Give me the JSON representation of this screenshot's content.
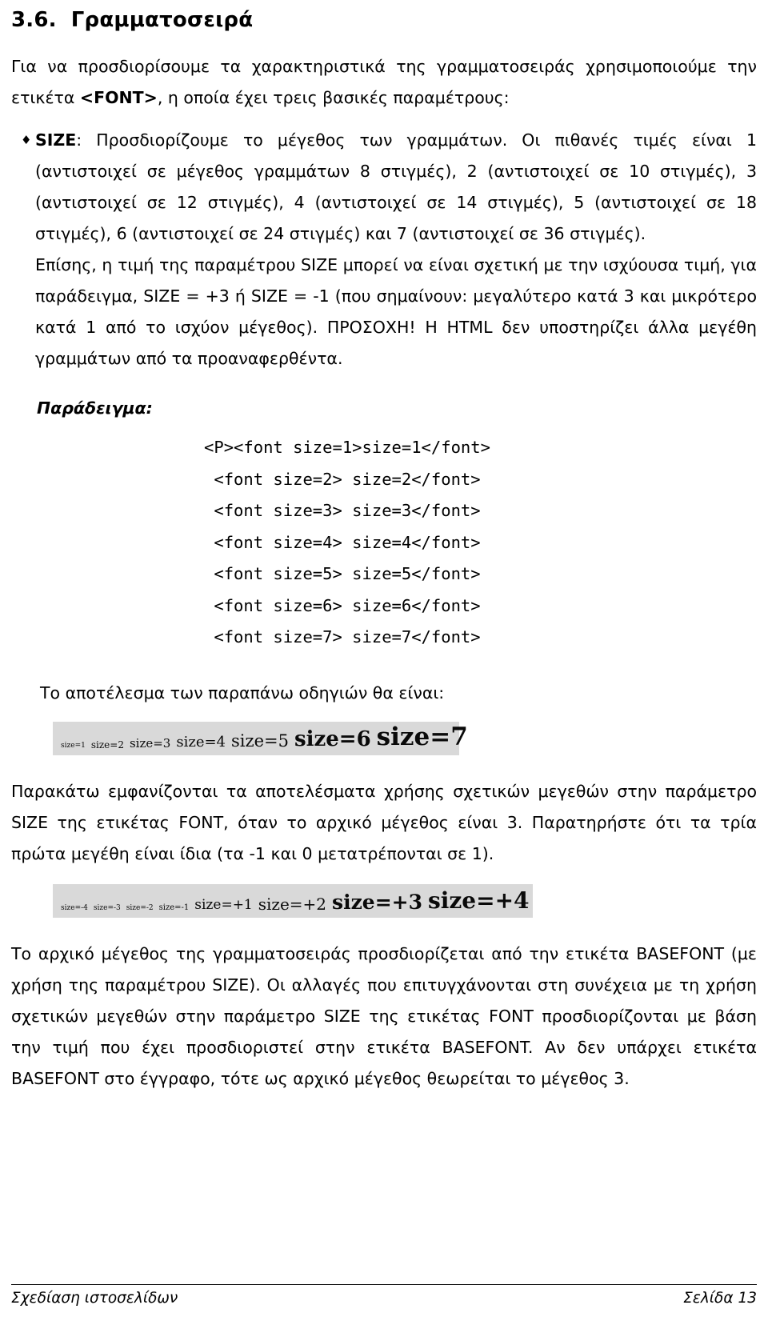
{
  "document": {
    "section": {
      "number": "3.6.",
      "title": "Γραμματοσειρά"
    },
    "intro": {
      "part1": "Για να προσδιορίσουμε τα χαρακτηριστικά της γραμματοσειράς χρησιμοποιούμε την ετικέτα ",
      "tag": "<FONT>",
      "part2": ", η οποία έχει τρεις βασικές παραμέτρους:"
    },
    "bullet": {
      "marker": "♦",
      "lead": "SIZE",
      "text": ": Προσδιορίζουμε το μέγεθος των γραμμάτων. Οι πιθανές τιμές είναι 1 (αντιστοιχεί σε μέγεθος γραμμάτων 8 στιγμές), 2 (αντιστοιχεί σε 10 στιγμές), 3 (αντιστοιχεί σε 12 στιγμές), 4 (αντιστοιχεί σε 14 στιγμές), 5 (αντιστοιχεί σε 18 στιγμές), 6 (αντιστοιχεί σε 24 στιγμές) και 7 (αντιστοιχεί σε 36 στιγμές).",
      "text2": "Επίσης, η τιμή της παραμέτρου SIZE μπορεί να είναι σχετική με την ισχύουσα τιμή, για παράδειγμα, SIZE = +3 ή SIZE = -1 (που σημαίνουν: μεγαλύτερο κατά 3 και μικρότερο κατά 1 από το ισχύον μέγεθος). ΠΡΟΣΟΧΗ! Η HTML δεν υποστηρίζει άλλα μεγέθη γραμμάτων από τα προαναφερθέντα."
    },
    "example": {
      "label": "Παράδειγμα:",
      "lines": [
        "<P><font size=1>size=1</font>",
        "<font size=2> size=2</font>",
        "<font size=3> size=3</font>",
        "<font size=4> size=4</font>",
        "<font size=5> size=5</font>",
        "<font size=6> size=6</font>",
        "<font size=7> size=7</font>"
      ]
    },
    "result_caption": "Το αποτέλεσμα των παραπάνω οδηγιών θα είναι:",
    "figure1": {
      "background_color": "#d9d9d9",
      "samples": [
        "size=1",
        "size=2",
        "size=3",
        "size=4",
        "size=5",
        "size=6",
        "size=7"
      ]
    },
    "paragraph_after_fig1": "Παρακάτω εμφανίζονται τα αποτελέσματα χρήσης σχετικών μεγεθών στην παράμετρο SIZE της ετικέτας FONT, όταν το αρχικό μέγεθος είναι 3. Παρατηρήστε ότι τα τρία πρώτα μεγέθη είναι ίδια (τα -1 και 0 μετατρέπονται σε 1).",
    "figure2": {
      "background_color": "#d9d9d9",
      "samples": [
        "size=-4",
        "size=-3",
        "size=-2",
        "size=-1",
        "size=+1",
        "size=+2",
        "size=+3",
        "size=+4"
      ]
    },
    "paragraph_after_fig2": "Το αρχικό μέγεθος της γραμματοσειράς προσδιορίζεται από την ετικέτα BASEFONT (με χρήση της παραμέτρου SIZE). Οι αλλαγές που επιτυγχάνονται στη συνέχεια με τη χρήση σχετικών μεγεθών στην παράμετρο SIZE της ετικέτας FONT προσδιορίζονται με βάση την τιμή που έχει προσδιοριστεί στην ετικέτα BASEFONT. Αν δεν υπάρχει ετικέτα BASEFONT στο έγγραφο, τότε ως αρχικό μέγεθος θεωρείται το μέγεθος 3.",
    "footer": {
      "left": "Σχεδίαση ιστοσελίδων",
      "right": "Σελίδα 13"
    }
  }
}
